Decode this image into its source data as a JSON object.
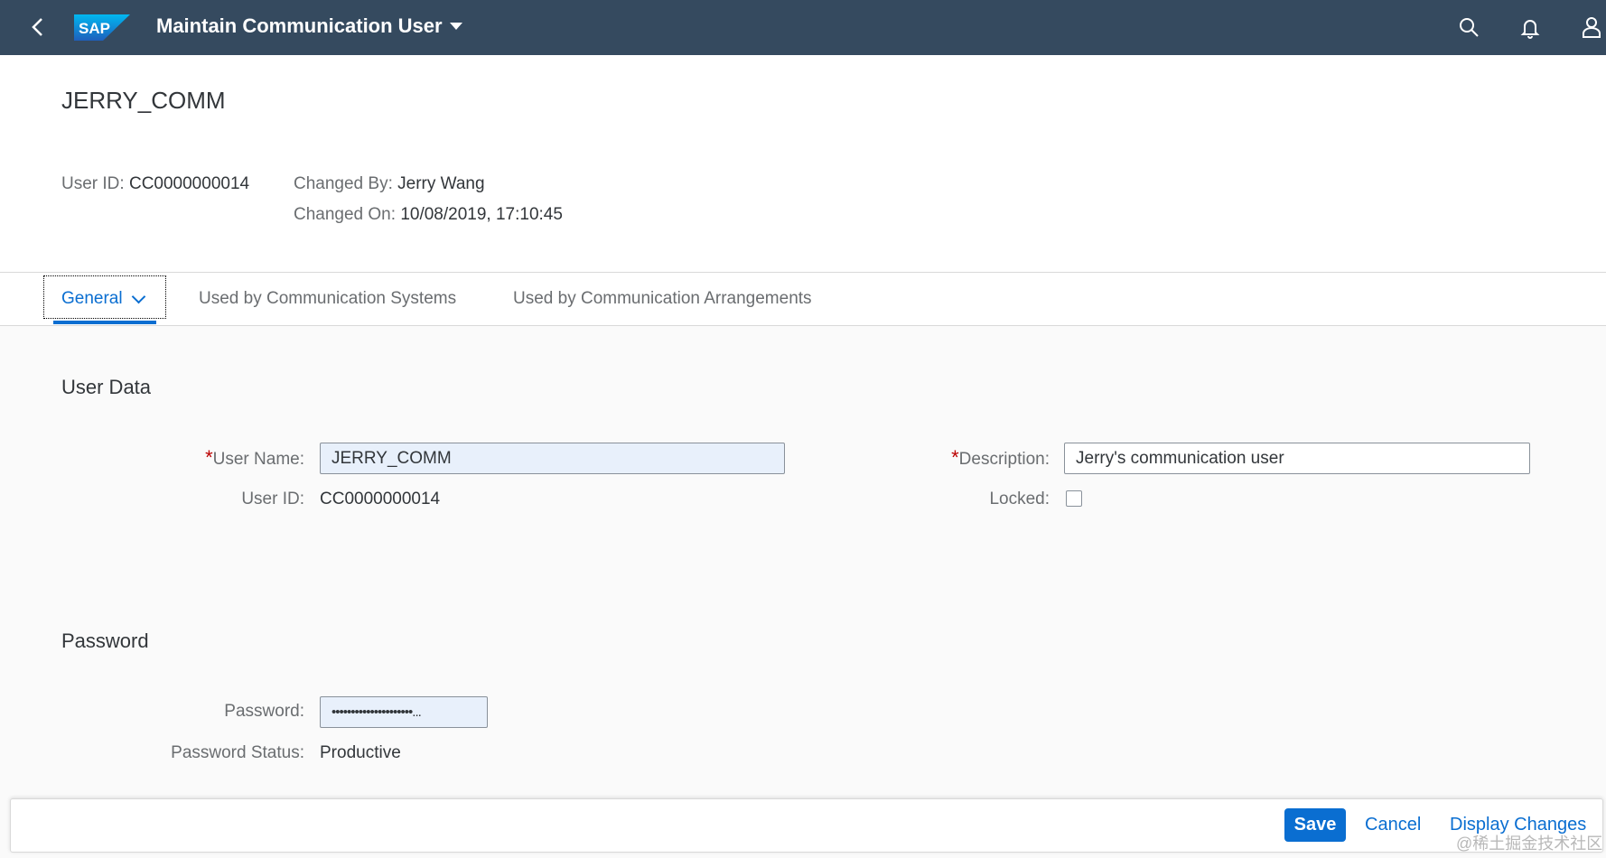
{
  "shell": {
    "title": "Maintain Communication User",
    "logo_text": "SAP",
    "icons": [
      "back-icon",
      "search-icon",
      "bell-icon",
      "user-icon"
    ]
  },
  "header": {
    "object_title": "JERRY_COMM",
    "user_id_label": "User ID:",
    "user_id_value": "CC0000000014",
    "changed_by_label": "Changed By:",
    "changed_by_value": "Jerry Wang",
    "changed_on_label": "Changed On:",
    "changed_on_value": "10/08/2019, 17:10:45"
  },
  "tabs": [
    {
      "label": "General",
      "active": true
    },
    {
      "label": "Used by Communication Systems",
      "active": false
    },
    {
      "label": "Used by Communication Arrangements",
      "active": false
    }
  ],
  "user_data": {
    "section_title": "User Data",
    "user_name_label": "User Name:",
    "user_name_value": "JERRY_COMM",
    "description_label": "Description:",
    "description_value": "Jerry's communication user",
    "user_id_label": "User ID:",
    "user_id_value": "CC0000000014",
    "locked_label": "Locked:",
    "locked": false
  },
  "password": {
    "section_title": "Password",
    "password_label": "Password:",
    "password_value": "•••••••••••••••••••••...",
    "status_label": "Password Status:",
    "status_value": "Productive"
  },
  "footer": {
    "save_label": "Save",
    "cancel_label": "Cancel",
    "display_changes_label": "Display Changes"
  },
  "watermark": "@稀土掘金技术社区",
  "colors": {
    "shell_bg": "#354a5f",
    "accent": "#0a6ed1",
    "required": "#bb0000"
  }
}
